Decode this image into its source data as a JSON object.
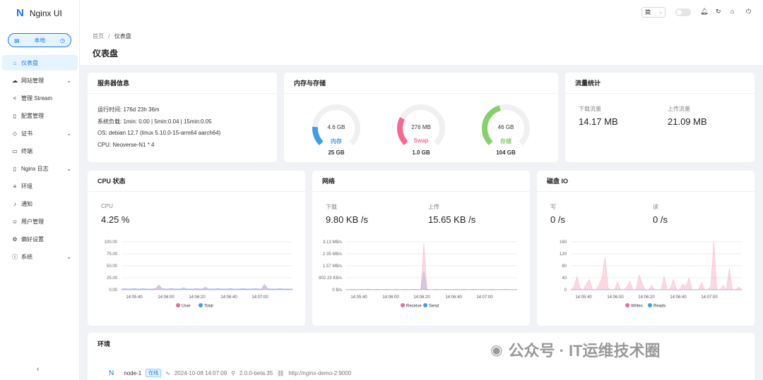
{
  "app": {
    "logo_letter": "N",
    "title": "Nginx UI"
  },
  "env_switch": {
    "label": "本地"
  },
  "sidebar": {
    "items": [
      {
        "label": "仪表盘",
        "icon": "home-icon",
        "glyph": "⌂",
        "active": true,
        "chevron": false
      },
      {
        "label": "网站管理",
        "icon": "cloud-icon",
        "glyph": "☁",
        "active": false,
        "chevron": true
      },
      {
        "label": "管理 Stream",
        "icon": "share-icon",
        "glyph": "<",
        "active": false,
        "chevron": false
      },
      {
        "label": "配置管理",
        "icon": "file-icon",
        "glyph": "▯",
        "active": false,
        "chevron": false
      },
      {
        "label": "证书",
        "icon": "shield-icon",
        "glyph": "◇",
        "active": false,
        "chevron": true
      },
      {
        "label": "终端",
        "icon": "terminal-icon",
        "glyph": "▭",
        "active": false,
        "chevron": false
      },
      {
        "label": "Nginx 日志",
        "icon": "log-icon",
        "glyph": "▯",
        "active": false,
        "chevron": true
      },
      {
        "label": "环境",
        "icon": "database-icon",
        "glyph": "≡",
        "active": false,
        "chevron": false
      },
      {
        "label": "通知",
        "icon": "bell-icon",
        "glyph": "♪",
        "active": false,
        "chevron": false
      },
      {
        "label": "用户管理",
        "icon": "user-icon",
        "glyph": "☺",
        "active": false,
        "chevron": false
      },
      {
        "label": "偏好设置",
        "icon": "gear-icon",
        "glyph": "⚙",
        "active": false,
        "chevron": false
      },
      {
        "label": "系统",
        "icon": "info-icon",
        "glyph": "ⓘ",
        "active": false,
        "chevron": true
      }
    ]
  },
  "topbar": {
    "lang": "简"
  },
  "breadcrumb": {
    "home": "首页",
    "separator": "/",
    "current": "仪表盘"
  },
  "page_title": "仪表盘",
  "server_info": {
    "title": "服务器信息",
    "uptime": "运行时间: 176d 23h 36m",
    "load": "系统负载: 1min: 0.00 | 5min:0.04 | 15min:0.05",
    "os": "OS: debian 12.7 (linux 5.10.0-15-arm64 aarch64)",
    "cpu": "CPU: Neoverse-N1 * 4"
  },
  "memory": {
    "title": "内存与存储",
    "gauges": [
      {
        "value": "4.6 GB",
        "label": "内存",
        "total": "25 GB",
        "fraction": 0.18,
        "color": "#3a9ee8"
      },
      {
        "value": "276 MB",
        "label": "Swap",
        "total": "1.0 GB",
        "fraction": 0.27,
        "color": "#f5698f"
      },
      {
        "value": "46 GB",
        "label": "存储",
        "total": "104 GB",
        "fraction": 0.44,
        "color": "#85d16c"
      }
    ]
  },
  "traffic": {
    "title": "流量统计",
    "download_label": "下载流量",
    "download_value": "14.17 MB",
    "upload_label": "上传流量",
    "upload_value": "21.09 MB"
  },
  "cpu": {
    "title": "CPU 状态",
    "stat_label": "CPU",
    "stat_value": "4.25 %"
  },
  "network": {
    "title": "网络",
    "download_label": "下载",
    "download_value": "9.80 KB /s",
    "upload_label": "上传",
    "upload_value": "15.65 KB /s"
  },
  "disk": {
    "title": "磁盘 IO",
    "write_label": "写",
    "write_value": "0 /s",
    "read_label": "读",
    "read_value": "0 /s"
  },
  "environment": {
    "title": "环境",
    "node_name": "node-1",
    "status": "在线",
    "time": "2024-10-08 14:07:09",
    "version": "2.0.0-beta.35",
    "url": "http://nginx-demo-2:9000"
  },
  "watermark": "公众号 · IT运维技术圈",
  "chart_data": [
    {
      "type": "area",
      "title": "CPU 状态",
      "x_ticks": [
        "14:05:40",
        "14:06:00",
        "14:06:20",
        "14:06:40",
        "14:07:00"
      ],
      "y_ticks": [
        "100.00",
        "75.00",
        "50.00",
        "25.00",
        "0.00"
      ],
      "ylim": [
        0,
        100
      ],
      "series": [
        {
          "name": "User",
          "color": "#f0688f",
          "values": [
            1,
            2,
            1,
            1,
            2,
            1,
            1,
            2,
            1,
            1,
            1,
            2,
            8,
            2,
            1,
            1,
            2,
            1,
            1,
            1,
            3,
            1,
            1,
            1,
            2,
            1,
            1,
            4,
            1,
            1,
            1,
            2,
            1,
            1,
            1,
            2,
            1,
            1,
            1,
            2,
            1,
            1,
            1,
            2,
            1,
            1,
            9,
            2,
            1,
            1,
            1,
            2,
            1,
            1,
            1,
            1
          ]
        },
        {
          "name": "Total",
          "color": "#3a9ee8",
          "values": [
            2,
            3,
            2,
            2,
            3,
            2,
            2,
            3,
            2,
            2,
            2,
            3,
            11,
            3,
            2,
            2,
            3,
            2,
            2,
            2,
            5,
            2,
            2,
            2,
            3,
            2,
            2,
            6,
            2,
            2,
            2,
            3,
            2,
            2,
            2,
            3,
            2,
            2,
            2,
            3,
            2,
            2,
            2,
            3,
            2,
            2,
            12,
            3,
            2,
            2,
            2,
            3,
            2,
            2,
            2,
            2
          ]
        }
      ],
      "legend": [
        "User",
        "Total"
      ],
      "legend_position": "bottom"
    },
    {
      "type": "area",
      "title": "网络",
      "x_ticks": [
        "14:05:40",
        "14:06:00",
        "14:06:20",
        "14:06:40",
        "14:07:00"
      ],
      "y_ticks": [
        "3.13 MB/s",
        "2.35 MB/s",
        "1.57 MB/s",
        "802.23 KB/s",
        "0 B/s"
      ],
      "ylim": [
        0,
        3.13
      ],
      "series": [
        {
          "name": "Receive",
          "color": "#f0688f",
          "values": [
            0.02,
            0.01,
            0.02,
            0.01,
            0.01,
            0.02,
            0.01,
            0.03,
            0.01,
            0.01,
            0.02,
            0.01,
            0.01,
            0.02,
            0.01,
            0.01,
            0.02,
            0.01,
            0.01,
            0.02,
            0.01,
            0.01,
            0.02,
            0.01,
            0.01,
            3.0,
            0.02,
            0.01,
            0.01,
            0.02,
            0.01,
            0.01,
            0.02,
            0.01,
            0.01,
            0.02,
            0.01,
            0.01,
            0.02,
            0.01,
            0.01,
            0.02,
            0.01,
            0.01,
            0.02,
            0.01,
            0.01,
            0.02,
            0.01,
            0.01,
            0.01,
            0.02,
            0.01,
            0.01,
            0.01,
            0.01
          ]
        },
        {
          "name": "Send",
          "color": "#3a9ee8",
          "values": [
            0.03,
            0.02,
            0.03,
            0.02,
            0.02,
            0.03,
            0.02,
            0.04,
            0.02,
            0.02,
            0.03,
            0.02,
            0.02,
            0.03,
            0.02,
            0.02,
            0.03,
            0.02,
            0.02,
            0.03,
            0.02,
            0.02,
            0.03,
            0.02,
            0.02,
            1.2,
            0.03,
            0.02,
            0.02,
            0.03,
            0.02,
            0.02,
            0.03,
            0.02,
            0.02,
            0.03,
            0.02,
            0.02,
            0.03,
            0.02,
            0.02,
            0.03,
            0.02,
            0.02,
            0.03,
            0.02,
            0.02,
            0.03,
            0.02,
            0.02,
            0.02,
            0.03,
            0.02,
            0.02,
            0.02,
            0.02
          ]
        }
      ],
      "legend": [
        "Receive",
        "Send"
      ],
      "legend_position": "bottom"
    },
    {
      "type": "area",
      "title": "磁盘 IO",
      "x_ticks": [
        "14:05:40",
        "14:06:00",
        "14:06:20",
        "14:06:40",
        "14:07:00"
      ],
      "y_ticks": [
        "160",
        "120",
        "80",
        "40",
        "0"
      ],
      "ylim": [
        0,
        160
      ],
      "series": [
        {
          "name": "Writes",
          "color": "#f0688f",
          "values": [
            0,
            10,
            45,
            5,
            0,
            20,
            35,
            0,
            0,
            15,
            40,
            110,
            5,
            0,
            0,
            25,
            0,
            0,
            10,
            30,
            0,
            0,
            50,
            20,
            0,
            0,
            15,
            0,
            0,
            0,
            45,
            0,
            5,
            35,
            0,
            0,
            20,
            10,
            40,
            0,
            0,
            0,
            25,
            0,
            0,
            10,
            160,
            0,
            0,
            15,
            0,
            70,
            0,
            0,
            10,
            0
          ]
        },
        {
          "name": "Reads",
          "color": "#3a9ee8",
          "values": [
            0,
            0,
            0,
            0,
            0,
            0,
            0,
            0,
            0,
            0,
            0,
            0,
            0,
            0,
            0,
            0,
            0,
            0,
            0,
            0,
            0,
            0,
            0,
            0,
            0,
            0,
            0,
            0,
            0,
            0,
            0,
            0,
            0,
            0,
            0,
            0,
            0,
            0,
            0,
            0,
            0,
            0,
            0,
            0,
            0,
            0,
            0,
            0,
            0,
            0,
            0,
            0,
            0,
            0,
            0,
            0
          ]
        }
      ],
      "legend": [
        "Writes",
        "Reads"
      ],
      "legend_position": "bottom"
    }
  ]
}
